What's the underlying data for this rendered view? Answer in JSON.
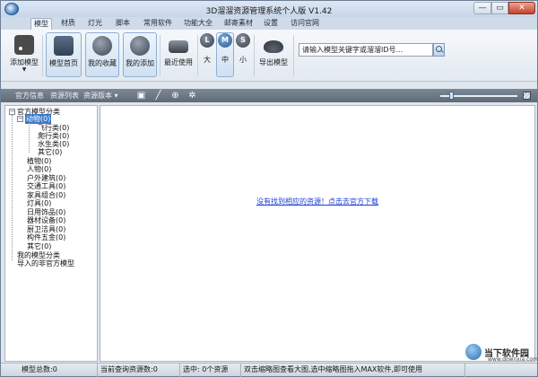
{
  "window": {
    "title": "3D溜溜资源管理系统个人版 V1.42"
  },
  "menu": [
    "模型",
    "材质",
    "灯光",
    "脚本",
    "常用软件",
    "功能大全",
    "邮寄素材",
    "设置",
    "访问官网"
  ],
  "ribbon": {
    "add_model": "添加模型",
    "model_home": "模型首页",
    "my_favorites": "我的收藏",
    "my_added": "我的添加",
    "recent": "最近使用",
    "size_large": "大",
    "size_medium": "中",
    "size_small": "小",
    "size_l_glyph": "L",
    "size_m_glyph": "M",
    "size_s_glyph": "S",
    "export_model": "导出模型",
    "search_placeholder": "请输入模型关键字或溜溜ID号..."
  },
  "subbar": {
    "official_info": "官方信息",
    "resource_list": "资源列表",
    "resource_version": "资源版本 ▾"
  },
  "tree": {
    "root": "官方模型分类",
    "animals": "动物(0)",
    "flying": "飞行类(0)",
    "crawling": "爬行类(0)",
    "aquatic": "水生类(0)",
    "other_animals": "其它(0)",
    "plants": "植物(0)",
    "people": "人物(0)",
    "outdoor": "户外建筑(0)",
    "transport": "交通工具(0)",
    "furniture": "家具组合(0)",
    "lights": "灯具(0)",
    "daily": "日用饰品(0)",
    "appliances": "器材设备(0)",
    "kitchen": "厨卫洁具(0)",
    "hardware": "构件五金(0)",
    "other": "其它(0)",
    "my_categories": "我的模型分类",
    "imported": "导入的非官方模型"
  },
  "main": {
    "empty_link": "没有找到相应的资源！点击去官方下载"
  },
  "status": {
    "total": "模型总数:0",
    "current_page": "当前查询资源数:0",
    "selected": "选中: 0个资源",
    "hint": "双击缩略图查看大图,选中缩略图拖入MAX软件,即可使用"
  },
  "watermark": {
    "name": "当下软件园",
    "url": "www.downxia.com"
  },
  "window_buttons": {
    "min": "—",
    "max": "▭",
    "close": "✕"
  },
  "icons": {
    "select": "▣",
    "pen": "╱",
    "zoom": "⊕",
    "settings": "✲"
  },
  "colors": {
    "accent": "#3a78c9",
    "link": "#1b3fd6",
    "subbar": "#6b7683"
  }
}
